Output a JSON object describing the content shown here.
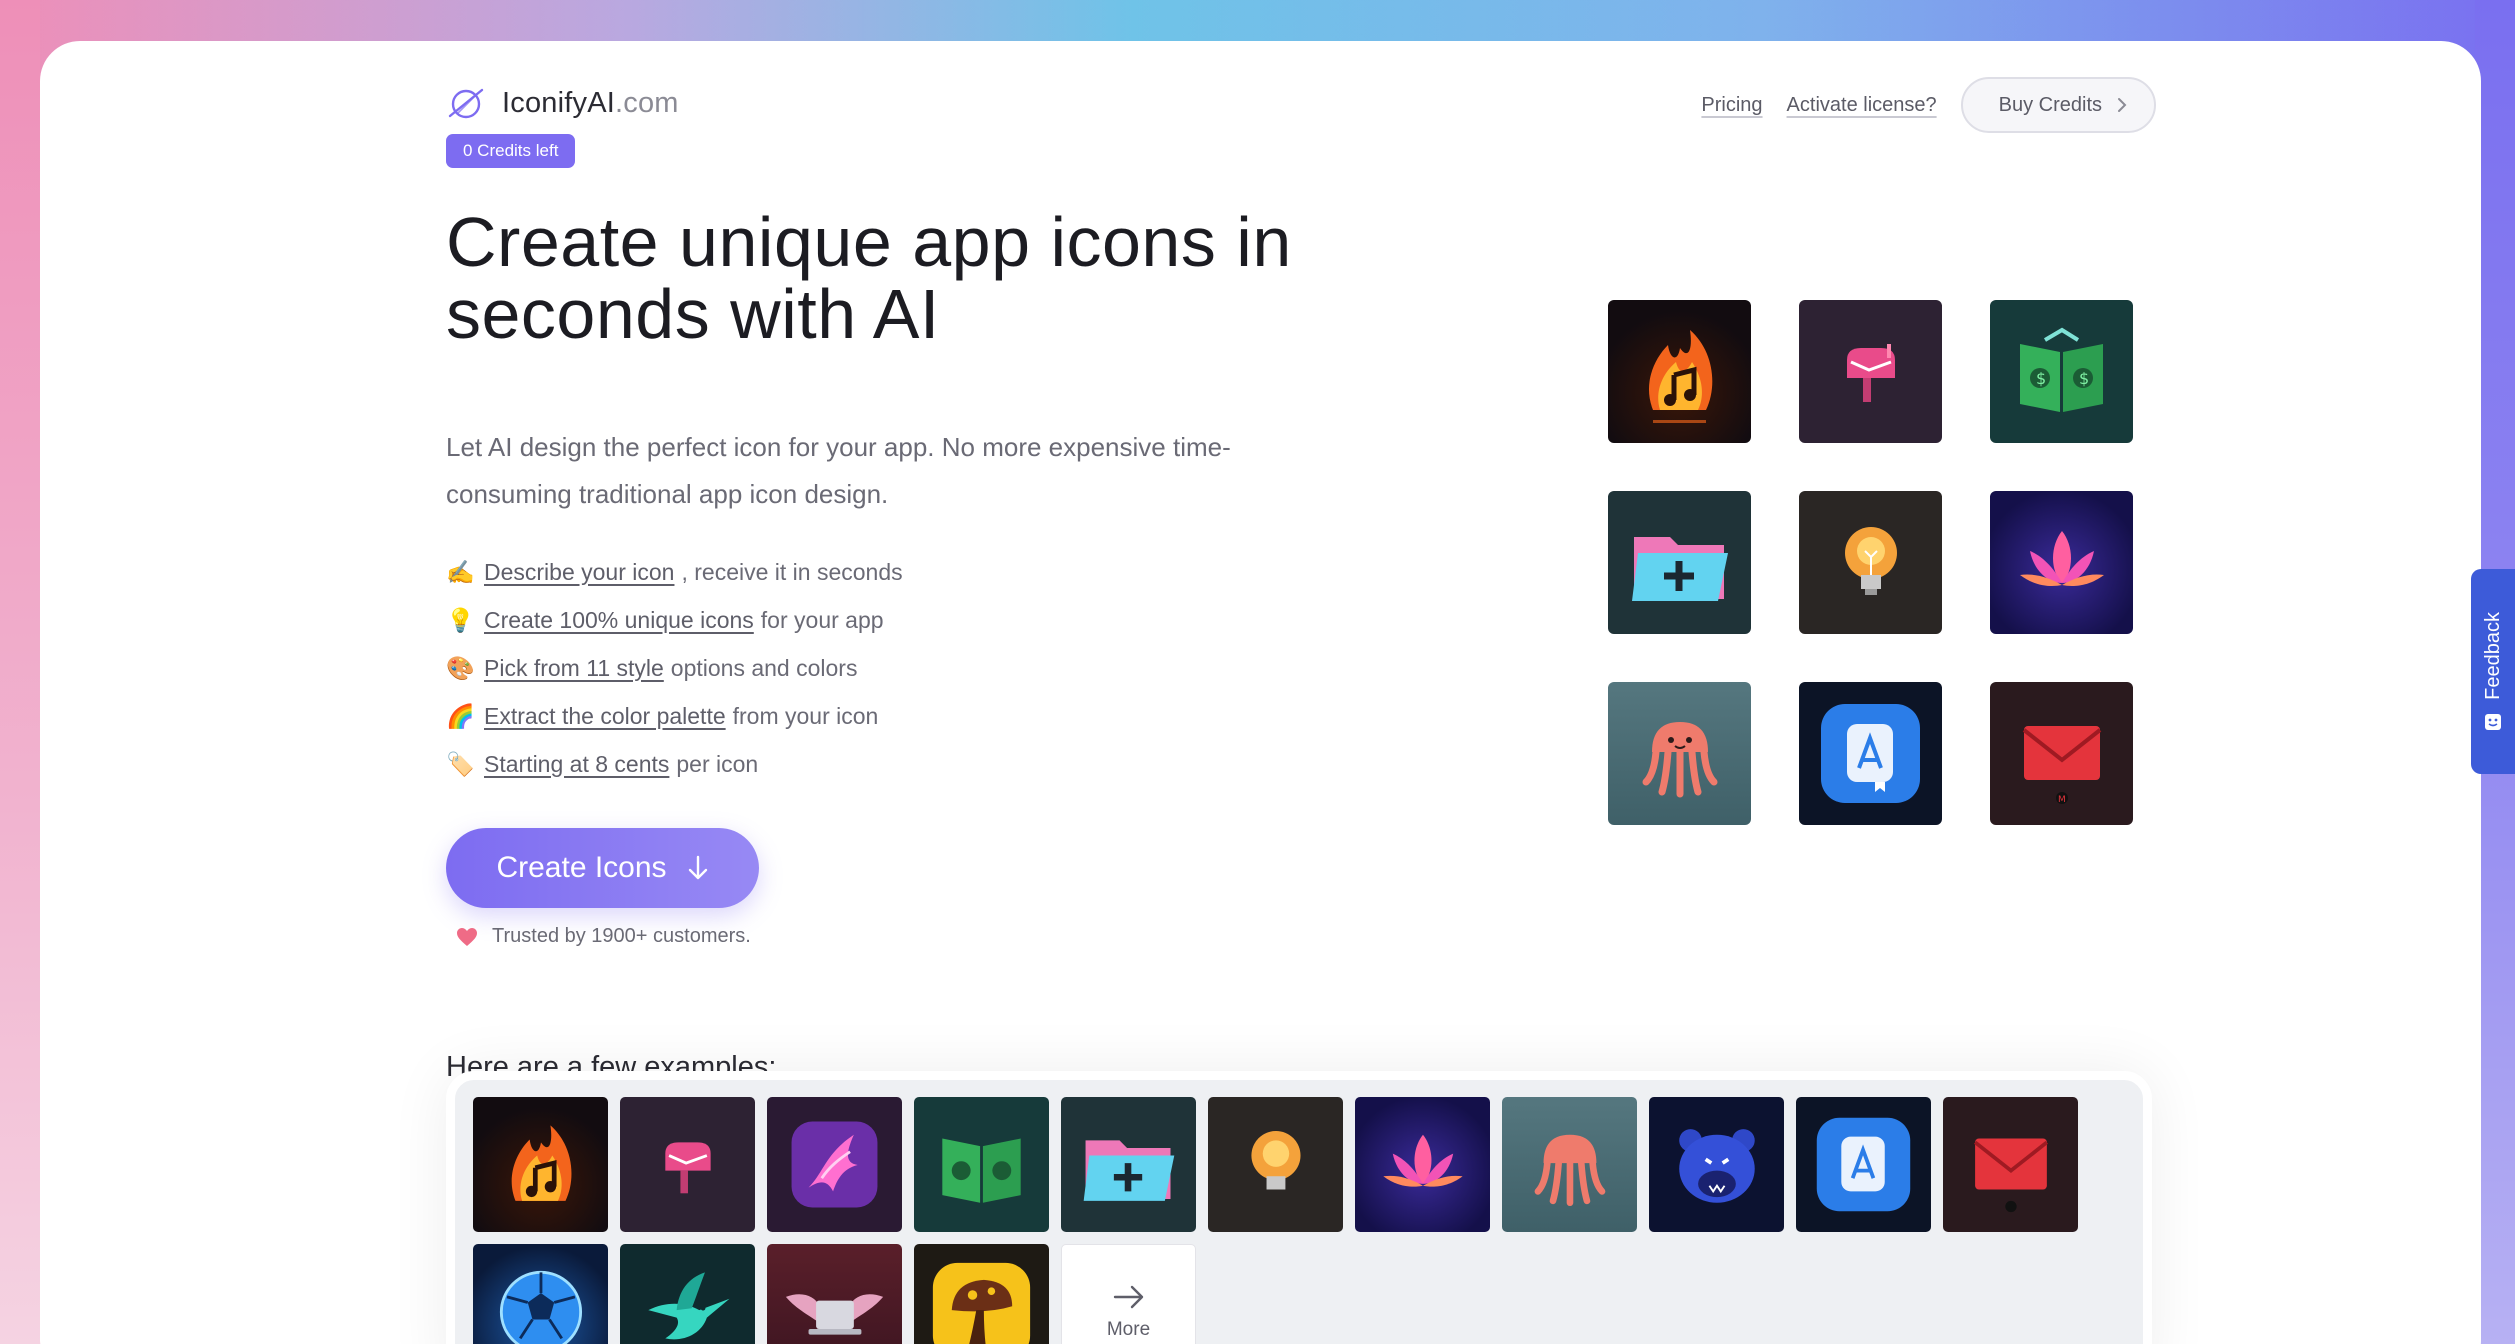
{
  "brand": {
    "name": "IconifyAI",
    "domain": ".com",
    "accent": "#7d6cf1"
  },
  "credits_badge": "0 Credits left",
  "nav": {
    "pricing": "Pricing",
    "activate": "Activate license?",
    "buy": "Buy Credits"
  },
  "hero": {
    "title": "Create unique app icons in seconds with AI",
    "subtitle": "Let AI design the perfect icon for your app. No more expensive time-consuming traditional app icon design."
  },
  "features": [
    {
      "emoji": "✍️",
      "link": "Describe your icon",
      "rest": ", receive it in seconds"
    },
    {
      "emoji": "💡",
      "link": "Create 100% unique icons",
      "rest": "for your app"
    },
    {
      "emoji": "🎨",
      "link": "Pick from 11 style",
      "rest": "options and colors"
    },
    {
      "emoji": "🌈",
      "link": "Extract the color palette",
      "rest": "from your icon"
    },
    {
      "emoji": "🏷️",
      "link": "Starting at 8 cents",
      "rest": "per icon"
    }
  ],
  "cta": {
    "label": "Create Icons"
  },
  "trusted": "Trusted by 1900+ customers.",
  "examples": {
    "title": "Here are a few examples:",
    "more_label": "More"
  },
  "feedback": {
    "label": "Feedback",
    "color": "#3d5bd9"
  },
  "showcase_icons": [
    "fire-music-icon",
    "mailbox-icon",
    "money-book-icon",
    "folder-plus-icon",
    "lightbulb-icon",
    "lotus-icon",
    "jellyfish-icon",
    "app-store-book-icon",
    "envelope-icon"
  ],
  "example_icons": [
    "fire-music-icon",
    "mailbox-icon",
    "phoenix-icon",
    "money-book-icon",
    "folder-plus-icon",
    "lightbulb-icon",
    "lotus-icon",
    "jellyfish-icon",
    "bear-icon",
    "app-store-book-icon",
    "envelope-icon",
    "soccer-ball-icon",
    "hummingbird-icon",
    "winged-laptop-icon",
    "mushroom-icon"
  ]
}
